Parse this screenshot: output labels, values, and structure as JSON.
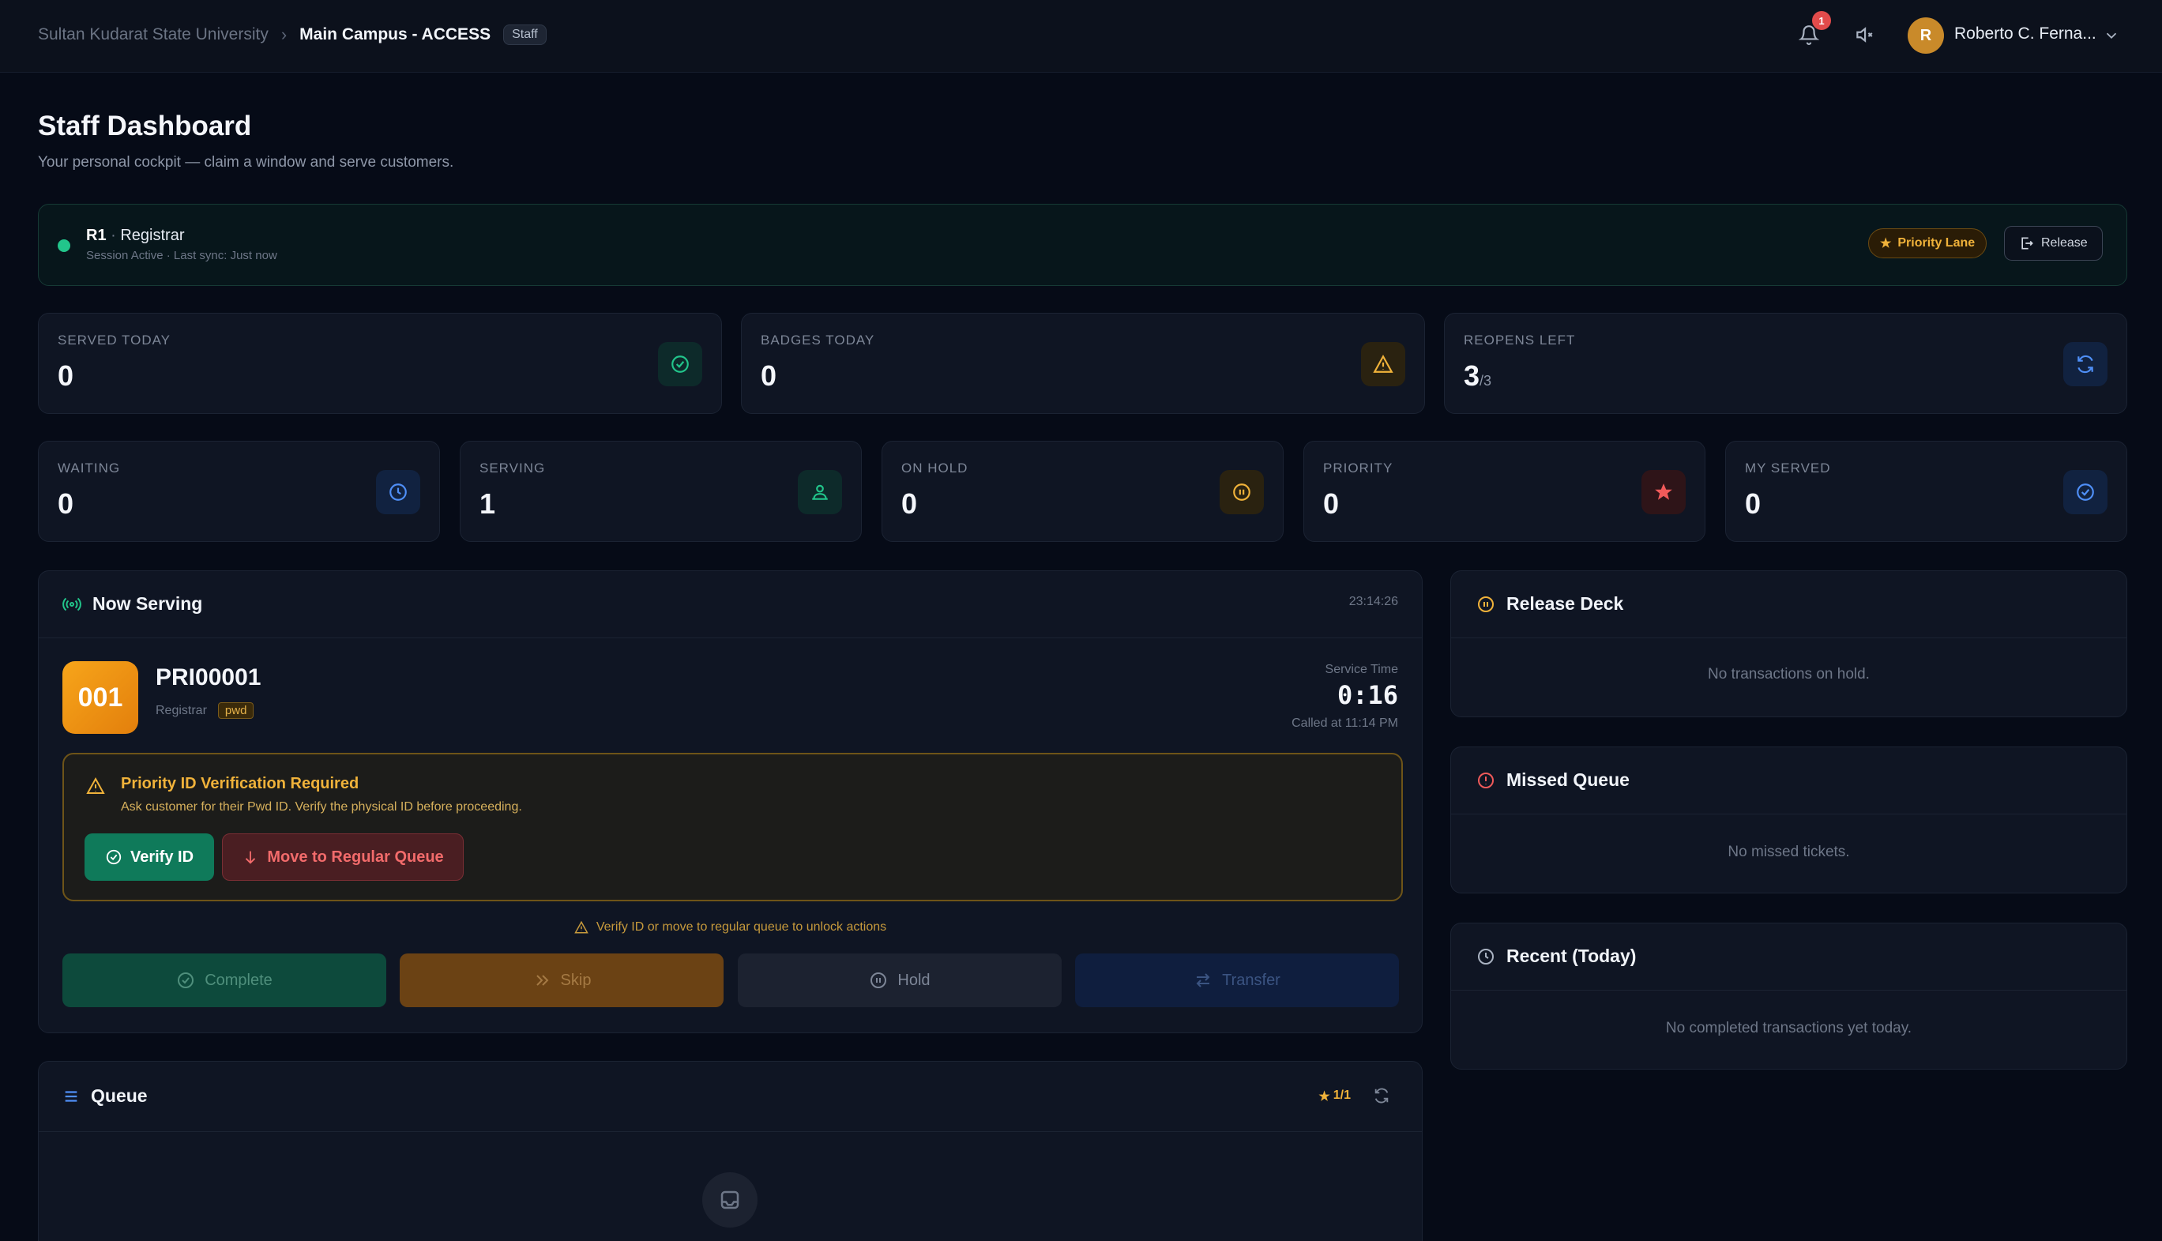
{
  "header": {
    "breadcrumb": [
      "Sultan Kudarat State University",
      "Main Campus - ACCESS"
    ],
    "role_badge": "Staff",
    "notification_count": "1",
    "avatar_initial": "R",
    "user_name": "Roberto C. Ferna..."
  },
  "page": {
    "title": "Staff Dashboard",
    "subtitle": "Your personal cockpit — claim a window and serve customers."
  },
  "session": {
    "window_code": "R1",
    "window_name": "Registrar",
    "status": "Session Active · Last sync: Just now",
    "priority_lane_label": "Priority Lane",
    "release_label": "Release"
  },
  "stats_top": [
    {
      "label": "SERVED TODAY",
      "value": "0",
      "icon": "check-circle-icon",
      "color": "#22c58b"
    },
    {
      "label": "BADGES TODAY",
      "value": "0",
      "icon": "warning-triangle-icon",
      "color": "#f0b23a"
    },
    {
      "label": "REOPENS LEFT",
      "value": "3",
      "suffix": "/3",
      "icon": "refresh-icon",
      "color": "#4f8ff7"
    }
  ],
  "stats_bottom": [
    {
      "label": "WAITING",
      "value": "0",
      "icon": "clock-icon",
      "color": "#4f8ff7"
    },
    {
      "label": "SERVING",
      "value": "1",
      "icon": "person-serving-icon",
      "color": "#22c58b"
    },
    {
      "label": "ON HOLD",
      "value": "0",
      "icon": "pause-circle-icon",
      "color": "#f0b23a"
    },
    {
      "label": "PRIORITY",
      "value": "0",
      "icon": "star-icon",
      "color": "#f05a5a"
    },
    {
      "label": "MY SERVED",
      "value": "0",
      "icon": "check-circle-icon",
      "color": "#4f8ff7"
    }
  ],
  "now_serving": {
    "title": "Now Serving",
    "clock": "23:14:26",
    "ticket_number": "001",
    "ticket_code": "PRI00001",
    "service": "Registrar",
    "tag": "pwd",
    "service_time_label": "Service Time",
    "service_time": "0:16",
    "called_at": "Called at 11:14 PM",
    "verify_title": "Priority ID Verification Required",
    "verify_text": "Ask customer for their Pwd ID. Verify the physical ID before proceeding.",
    "verify_button": "Verify ID",
    "move_button": "Move to Regular Queue",
    "unlock_hint": "Verify ID or move to regular queue to unlock actions",
    "actions": [
      "Complete",
      "Skip",
      "Hold",
      "Transfer"
    ]
  },
  "queue": {
    "title": "Queue",
    "priority_count": "1/1"
  },
  "release_deck": {
    "title": "Release Deck",
    "empty": "No transactions on hold."
  },
  "missed_queue": {
    "title": "Missed Queue",
    "empty": "No missed tickets."
  },
  "recent": {
    "title": "Recent (Today)",
    "empty": "No completed transactions yet today."
  }
}
